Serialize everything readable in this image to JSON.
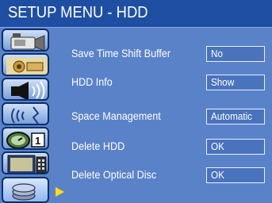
{
  "header": {
    "title": "SETUP MENU - HDD"
  },
  "sidebar": {
    "tabs": [
      {
        "icon": "video-camera-icon"
      },
      {
        "icon": "projector-icon"
      },
      {
        "icon": "speaker-icon"
      },
      {
        "icon": "signal-waves-icon"
      },
      {
        "icon": "clock-calendar-icon"
      },
      {
        "icon": "tv-remote-icon"
      },
      {
        "icon": "hard-disk-icon",
        "selected": true
      }
    ],
    "pointer_color": "#ffe000"
  },
  "settings": [
    {
      "label": "Save Time Shift Buffer",
      "value": "No"
    },
    {
      "label": "HDD Info",
      "value": "Show"
    },
    {
      "label": "Space Management",
      "value": "Automatic"
    },
    {
      "label": "Delete HDD",
      "value": "OK"
    },
    {
      "label": "Delete Optical Disc",
      "value": "OK"
    }
  ],
  "colors": {
    "background": "#5a82c8",
    "title_bar": "#1f4fa3",
    "text": "#ffffff"
  }
}
